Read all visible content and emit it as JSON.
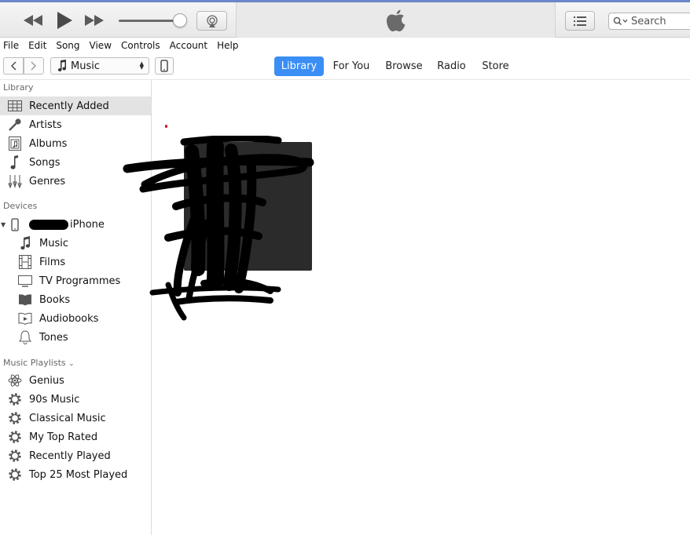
{
  "colors": {
    "accent": "#3a8ef5",
    "titlebar_stripe": "#6b86c9",
    "selection": "#e3e3e3"
  },
  "player": {
    "prev_icon": "rewind-icon",
    "play_icon": "play-icon",
    "next_icon": "fast-forward-icon",
    "airplay_icon": "airplay-icon",
    "lcd_icon": "apple-logo",
    "list_icon": "list-icon",
    "search_placeholder": "Search"
  },
  "menu": [
    "File",
    "Edit",
    "Song",
    "View",
    "Controls",
    "Account",
    "Help"
  ],
  "nav": {
    "media_kind": "Music",
    "tabs": [
      "Library",
      "For You",
      "Browse",
      "Radio",
      "Store"
    ],
    "active_tab": "Library"
  },
  "sidebar": {
    "library_header": "Library",
    "library_items": [
      {
        "label": "Recently Added",
        "icon": "grid-icon",
        "selected": true
      },
      {
        "label": "Artists",
        "icon": "microphone-icon"
      },
      {
        "label": "Albums",
        "icon": "album-icon"
      },
      {
        "label": "Songs",
        "icon": "music-note-icon"
      },
      {
        "label": "Genres",
        "icon": "instruments-icon"
      }
    ],
    "devices_header": "Devices",
    "device": {
      "label": "iPhone",
      "icon": "iphone-icon"
    },
    "device_items": [
      {
        "label": "Music",
        "icon": "music-note-icon"
      },
      {
        "label": "Films",
        "icon": "film-icon"
      },
      {
        "label": "TV Programmes",
        "icon": "tv-icon"
      },
      {
        "label": "Books",
        "icon": "book-icon"
      },
      {
        "label": "Audiobooks",
        "icon": "audiobook-icon"
      },
      {
        "label": "Tones",
        "icon": "bell-icon"
      }
    ],
    "playlists_header": "Music Playlists",
    "playlists": [
      {
        "label": "Genius",
        "icon": "genius-atom-icon"
      },
      {
        "label": "90s Music",
        "icon": "gear-icon"
      },
      {
        "label": "Classical Music",
        "icon": "gear-icon"
      },
      {
        "label": "My Top Rated",
        "icon": "gear-icon"
      },
      {
        "label": "Recently Played",
        "icon": "gear-icon"
      },
      {
        "label": "Top 25 Most Played",
        "icon": "gear-icon"
      }
    ]
  }
}
